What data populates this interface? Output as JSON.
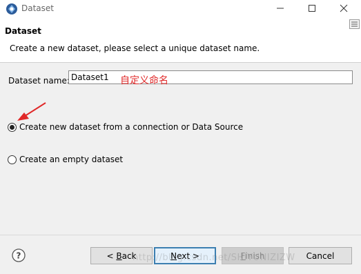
{
  "window": {
    "title": "Dataset",
    "app_icon": "eclipse-icon",
    "controls": [
      "minimize-icon",
      "maximize-icon",
      "close-icon"
    ]
  },
  "header": {
    "title": "Dataset",
    "description": "Create a new dataset, please select a unique dataset name."
  },
  "form": {
    "name_label": "Dataset name:",
    "name_value": "Dataset1",
    "annotation": "自定义命名"
  },
  "options": [
    {
      "label": "Create new dataset from a connection or Data Source",
      "selected": true
    },
    {
      "label": "Create an empty dataset",
      "selected": false
    }
  ],
  "buttons": {
    "back_prefix": "< ",
    "back_mnemonic": "B",
    "back_rest": "ack",
    "next_mnemonic": "N",
    "next_rest": "ext >",
    "finish_mnemonic": "F",
    "finish_rest": "inish",
    "finish_enabled": false,
    "cancel": "Cancel"
  },
  "watermark": "http://blog.csdn.net/SHIYUNIZIZW",
  "colors": {
    "annotation": "#e02828",
    "default_button_border": "#3c7fb1"
  }
}
